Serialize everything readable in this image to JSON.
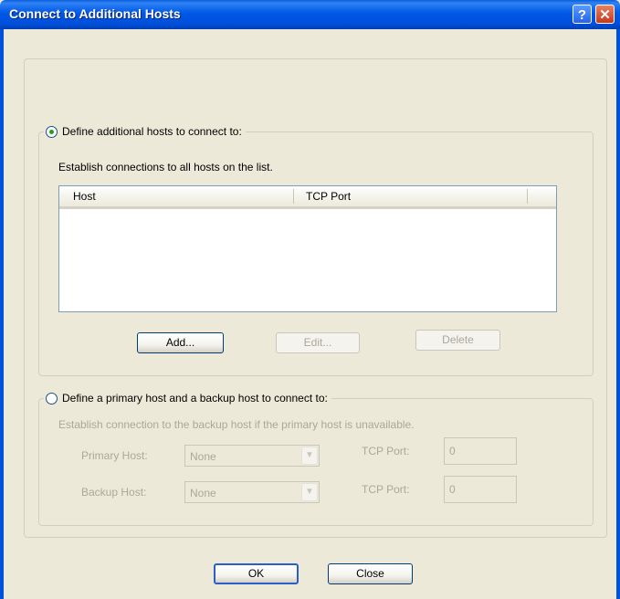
{
  "window": {
    "title": "Connect to Additional Hosts",
    "help_glyph": "?",
    "close_glyph": "✕"
  },
  "group1": {
    "option_label": "Define additional hosts to connect to:",
    "selected": true,
    "description": "Establish connections to all hosts on the list.",
    "list": {
      "columns": [
        "Host",
        "TCP Port"
      ],
      "rows": []
    },
    "buttons": {
      "add": "Add...",
      "edit": "Edit...",
      "delete": "Delete"
    }
  },
  "group2": {
    "option_label": "Define a primary host and a backup host to connect to:",
    "selected": false,
    "description": "Establish connection to the backup host if the primary host is unavailable.",
    "primary_host_label": "Primary Host:",
    "primary_host_value": "None",
    "primary_port_label": "TCP Port:",
    "primary_port_value": "0",
    "backup_host_label": "Backup Host:",
    "backup_host_value": "None",
    "backup_port_label": "TCP Port:",
    "backup_port_value": "0",
    "dropdown_glyph": "▼"
  },
  "footer": {
    "ok": "OK",
    "close": "Close"
  }
}
